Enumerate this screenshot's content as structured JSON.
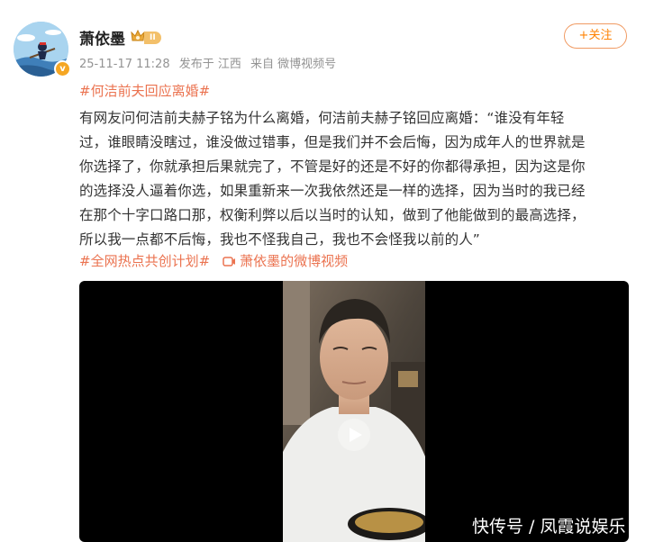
{
  "user": {
    "name": "萧依墨",
    "level_badge": "II",
    "verified_mark": "v"
  },
  "meta": {
    "time": "25-11-17 11:28",
    "location": "发布于 江西",
    "source": "来自 微博视频号"
  },
  "follow_button": "+关注",
  "topic": "#何洁前夫回应离婚#",
  "post_lines": [
    "有网友问何洁前夫赫子铭为什么离婚，何洁前夫赫子铭回应离婚：“谁没有年轻",
    "过，谁眼睛没瞎过，谁没做过错事，但是我们并不会后悔，因为成年人的世界就是",
    "你选择了，你就承担后果就完了，不管是好的还是不好的你都得承担，因为这是你",
    "的选择没人逼着你选，如果重新来一次我依然还是一样的选择，因为当时的我已经",
    "在那个十字口路口那，权衡利弊以后以当时的认知，做到了他能做到的最高选择，",
    "所以我一点都不后悔，我也不怪我自己，我也不会怪我以前的人”"
  ],
  "tags": {
    "hot_plan": "#全网热点共创计划#",
    "video_link": "萧依墨的微博视频"
  },
  "watermark": "快传号 / 凤霞说娱乐",
  "icons": {
    "crown": "crown-icon",
    "video": "video-icon",
    "play": "play-icon"
  },
  "colors": {
    "accent": "#eb7350",
    "follow": "#ff8200",
    "meta": "#939393"
  }
}
